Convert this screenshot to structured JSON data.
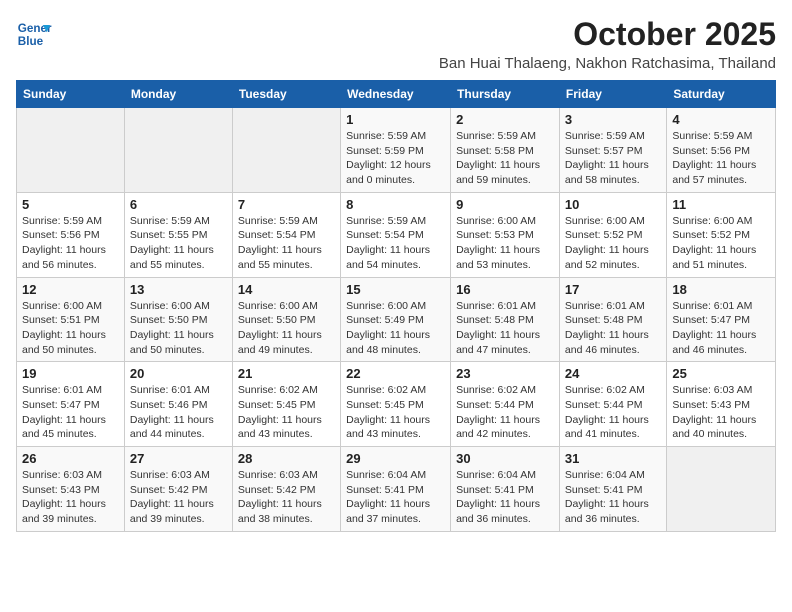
{
  "header": {
    "logo_line1": "General",
    "logo_line2": "Blue",
    "month": "October 2025",
    "location": "Ban Huai Thalaeng, Nakhon Ratchasima, Thailand"
  },
  "weekdays": [
    "Sunday",
    "Monday",
    "Tuesday",
    "Wednesday",
    "Thursday",
    "Friday",
    "Saturday"
  ],
  "weeks": [
    [
      {
        "day": "",
        "info": ""
      },
      {
        "day": "",
        "info": ""
      },
      {
        "day": "",
        "info": ""
      },
      {
        "day": "1",
        "info": "Sunrise: 5:59 AM\nSunset: 5:59 PM\nDaylight: 12 hours\nand 0 minutes."
      },
      {
        "day": "2",
        "info": "Sunrise: 5:59 AM\nSunset: 5:58 PM\nDaylight: 11 hours\nand 59 minutes."
      },
      {
        "day": "3",
        "info": "Sunrise: 5:59 AM\nSunset: 5:57 PM\nDaylight: 11 hours\nand 58 minutes."
      },
      {
        "day": "4",
        "info": "Sunrise: 5:59 AM\nSunset: 5:56 PM\nDaylight: 11 hours\nand 57 minutes."
      }
    ],
    [
      {
        "day": "5",
        "info": "Sunrise: 5:59 AM\nSunset: 5:56 PM\nDaylight: 11 hours\nand 56 minutes."
      },
      {
        "day": "6",
        "info": "Sunrise: 5:59 AM\nSunset: 5:55 PM\nDaylight: 11 hours\nand 55 minutes."
      },
      {
        "day": "7",
        "info": "Sunrise: 5:59 AM\nSunset: 5:54 PM\nDaylight: 11 hours\nand 55 minutes."
      },
      {
        "day": "8",
        "info": "Sunrise: 5:59 AM\nSunset: 5:54 PM\nDaylight: 11 hours\nand 54 minutes."
      },
      {
        "day": "9",
        "info": "Sunrise: 6:00 AM\nSunset: 5:53 PM\nDaylight: 11 hours\nand 53 minutes."
      },
      {
        "day": "10",
        "info": "Sunrise: 6:00 AM\nSunset: 5:52 PM\nDaylight: 11 hours\nand 52 minutes."
      },
      {
        "day": "11",
        "info": "Sunrise: 6:00 AM\nSunset: 5:52 PM\nDaylight: 11 hours\nand 51 minutes."
      }
    ],
    [
      {
        "day": "12",
        "info": "Sunrise: 6:00 AM\nSunset: 5:51 PM\nDaylight: 11 hours\nand 50 minutes."
      },
      {
        "day": "13",
        "info": "Sunrise: 6:00 AM\nSunset: 5:50 PM\nDaylight: 11 hours\nand 50 minutes."
      },
      {
        "day": "14",
        "info": "Sunrise: 6:00 AM\nSunset: 5:50 PM\nDaylight: 11 hours\nand 49 minutes."
      },
      {
        "day": "15",
        "info": "Sunrise: 6:00 AM\nSunset: 5:49 PM\nDaylight: 11 hours\nand 48 minutes."
      },
      {
        "day": "16",
        "info": "Sunrise: 6:01 AM\nSunset: 5:48 PM\nDaylight: 11 hours\nand 47 minutes."
      },
      {
        "day": "17",
        "info": "Sunrise: 6:01 AM\nSunset: 5:48 PM\nDaylight: 11 hours\nand 46 minutes."
      },
      {
        "day": "18",
        "info": "Sunrise: 6:01 AM\nSunset: 5:47 PM\nDaylight: 11 hours\nand 46 minutes."
      }
    ],
    [
      {
        "day": "19",
        "info": "Sunrise: 6:01 AM\nSunset: 5:47 PM\nDaylight: 11 hours\nand 45 minutes."
      },
      {
        "day": "20",
        "info": "Sunrise: 6:01 AM\nSunset: 5:46 PM\nDaylight: 11 hours\nand 44 minutes."
      },
      {
        "day": "21",
        "info": "Sunrise: 6:02 AM\nSunset: 5:45 PM\nDaylight: 11 hours\nand 43 minutes."
      },
      {
        "day": "22",
        "info": "Sunrise: 6:02 AM\nSunset: 5:45 PM\nDaylight: 11 hours\nand 43 minutes."
      },
      {
        "day": "23",
        "info": "Sunrise: 6:02 AM\nSunset: 5:44 PM\nDaylight: 11 hours\nand 42 minutes."
      },
      {
        "day": "24",
        "info": "Sunrise: 6:02 AM\nSunset: 5:44 PM\nDaylight: 11 hours\nand 41 minutes."
      },
      {
        "day": "25",
        "info": "Sunrise: 6:03 AM\nSunset: 5:43 PM\nDaylight: 11 hours\nand 40 minutes."
      }
    ],
    [
      {
        "day": "26",
        "info": "Sunrise: 6:03 AM\nSunset: 5:43 PM\nDaylight: 11 hours\nand 39 minutes."
      },
      {
        "day": "27",
        "info": "Sunrise: 6:03 AM\nSunset: 5:42 PM\nDaylight: 11 hours\nand 39 minutes."
      },
      {
        "day": "28",
        "info": "Sunrise: 6:03 AM\nSunset: 5:42 PM\nDaylight: 11 hours\nand 38 minutes."
      },
      {
        "day": "29",
        "info": "Sunrise: 6:04 AM\nSunset: 5:41 PM\nDaylight: 11 hours\nand 37 minutes."
      },
      {
        "day": "30",
        "info": "Sunrise: 6:04 AM\nSunset: 5:41 PM\nDaylight: 11 hours\nand 36 minutes."
      },
      {
        "day": "31",
        "info": "Sunrise: 6:04 AM\nSunset: 5:41 PM\nDaylight: 11 hours\nand 36 minutes."
      },
      {
        "day": "",
        "info": ""
      }
    ]
  ]
}
